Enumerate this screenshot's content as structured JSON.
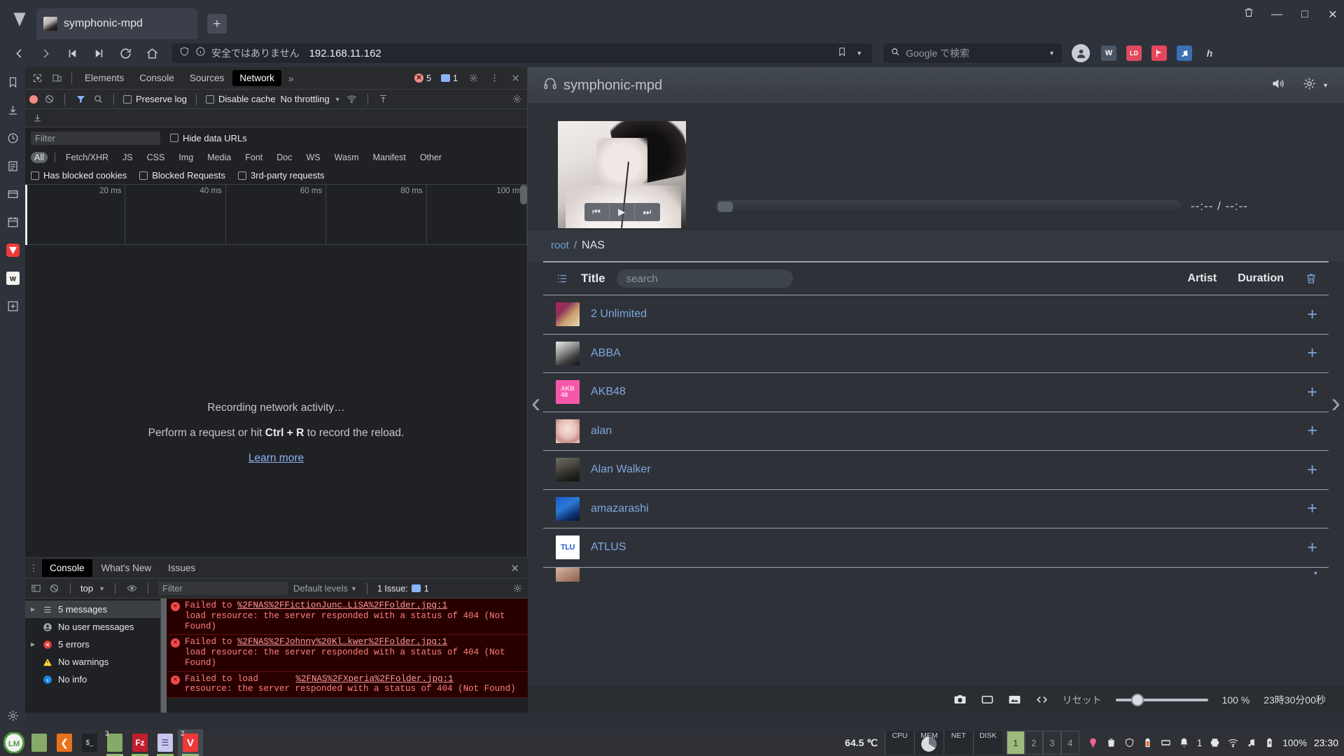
{
  "browser": {
    "tab": {
      "title": "symphonic-mpd",
      "favicon": "album-art-favicon"
    },
    "new_tab_label": "+",
    "window_controls": {
      "trash": "Ὕ1",
      "minimize": "—",
      "maximize": "□",
      "close": "✕"
    },
    "nav": {
      "back": "back-icon",
      "forward": "forward-icon",
      "rewind": "rewind-icon",
      "fastforward": "fastforward-icon",
      "reload": "reload-icon",
      "home": "home-icon"
    },
    "address": {
      "security_label": "安全ではありません",
      "url": "192.168.11.162"
    },
    "search": {
      "placeholder": "Google で検索"
    },
    "extensions": [
      "W",
      "LD",
      "flag-icon",
      "music-icon",
      "h"
    ]
  },
  "rail": {
    "items": [
      {
        "name": "bookmarks"
      },
      {
        "name": "downloads"
      },
      {
        "name": "history"
      },
      {
        "name": "notes"
      },
      {
        "name": "window-panel"
      },
      {
        "name": "calendar"
      },
      {
        "name": "vivaldi-web-panel"
      },
      {
        "name": "wikipedia-web-panel"
      },
      {
        "name": "add-web-panel"
      }
    ],
    "settings": "settings-gear"
  },
  "devtools": {
    "tabs": [
      {
        "label": "Elements",
        "active": false
      },
      {
        "label": "Console",
        "active": false
      },
      {
        "label": "Sources",
        "active": false
      },
      {
        "label": "Network",
        "active": true
      }
    ],
    "more_tabs": "»",
    "error_count": "5",
    "message_count": "1",
    "network_toolbar": {
      "preserve_log": "Preserve log",
      "disable_cache": "Disable cache",
      "throttling": "No throttling"
    },
    "filter": {
      "placeholder": "Filter",
      "hide_data_urls": "Hide data URLs"
    },
    "types": [
      "All",
      "Fetch/XHR",
      "JS",
      "CSS",
      "Img",
      "Media",
      "Font",
      "Doc",
      "WS",
      "Wasm",
      "Manifest",
      "Other"
    ],
    "active_type": "All",
    "checkboxes": [
      "Has blocked cookies",
      "Blocked Requests",
      "3rd-party requests"
    ],
    "timeline_ticks": [
      "20 ms",
      "40 ms",
      "60 ms",
      "80 ms",
      "100 ms"
    ],
    "empty_state": {
      "line1": "Recording network activity…",
      "line2_prefix": "Perform a request or hit ",
      "line2_key": "Ctrl + R",
      "line2_suffix": " to record the reload.",
      "learn_more": "Learn more"
    },
    "drawer": {
      "tabs": [
        {
          "label": "Console",
          "active": true
        },
        {
          "label": "What's New",
          "active": false
        },
        {
          "label": "Issues",
          "active": false
        }
      ],
      "context": "top",
      "filter_placeholder": "Filter",
      "levels": "Default levels",
      "issue_badge": "1 Issue:",
      "issue_count": "1",
      "sidebar": [
        {
          "label": "5 messages",
          "icon": "list-icon",
          "expandable": true,
          "selected": true
        },
        {
          "label": "No user messages",
          "icon": "user-icon",
          "expandable": false,
          "selected": false
        },
        {
          "label": "5 errors",
          "icon": "error-icon",
          "expandable": true,
          "selected": false
        },
        {
          "label": "No warnings",
          "icon": "warning-icon",
          "expandable": false,
          "selected": false
        },
        {
          "label": "No info",
          "icon": "info-icon",
          "expandable": false,
          "selected": false
        }
      ],
      "logs": [
        {
          "pre": "Failed to ",
          "link": "%2FNAS%2FFictionJunc…LiSA%2FFolder.jpg:1",
          "body": "load resource: the server responded with a status of 404 (Not Found)"
        },
        {
          "pre": "Failed to ",
          "link": "%2FNAS%2FJohnny%20Kl…kwer%2FFolder.jpg:1",
          "body": "load resource: the server responded with a status of 404 (Not Found)"
        },
        {
          "pre": "Failed to load ",
          "link": "%2FNAS%2FXperia%2FFolder.jpg:1",
          "body": "resource: the server responded with a status of 404 (Not Found)"
        }
      ]
    }
  },
  "app": {
    "title": "symphonic-mpd",
    "header_icons": [
      "volume-icon",
      "settings-gear-icon"
    ],
    "player": {
      "prev_label": "⏮",
      "play_label": "▶",
      "next_label": "⏭",
      "elapsed": "--:--",
      "separator": "/",
      "total": "--:--"
    },
    "breadcrumb": {
      "root": "root",
      "separator": "/",
      "current": "NAS"
    },
    "list_header": {
      "title": "Title",
      "search_placeholder": "search",
      "artist": "Artist",
      "duration": "Duration",
      "trash": "delete-icon"
    },
    "rows": [
      {
        "name": "2 Unlimited",
        "thumb": "artist-thumb-2unlimited",
        "add": "+"
      },
      {
        "name": "ABBA",
        "thumb": "artist-thumb-abba",
        "add": "+"
      },
      {
        "name": "AKB48",
        "thumb": "artist-thumb-akb48",
        "add": "+"
      },
      {
        "name": "alan",
        "thumb": "artist-thumb-alan",
        "add": "+"
      },
      {
        "name": "Alan Walker",
        "thumb": "artist-thumb-alanwalker",
        "add": "+"
      },
      {
        "name": "amazarashi",
        "thumb": "artist-thumb-amazarashi",
        "add": "+"
      },
      {
        "name": "ATLUS",
        "thumb": "artist-thumb-atlus",
        "add": "+"
      }
    ],
    "nav_prev": "‹",
    "nav_next": "›",
    "footer": {
      "icons": [
        "camera-icon",
        "screen-icon",
        "image-icon",
        "code-icon"
      ],
      "reset": "リセット",
      "zoom": "100 %",
      "time": "23時30分00秒"
    }
  },
  "taskbar": {
    "launchers": [
      {
        "name": "menu",
        "badge": "",
        "running": false
      },
      {
        "name": "file-manager",
        "badge": "",
        "running": false
      },
      {
        "name": "firefox",
        "badge": "",
        "running": false
      },
      {
        "name": "terminal",
        "badge": "",
        "running": false
      },
      {
        "name": "files",
        "badge": "3",
        "running": false
      },
      {
        "name": "filezilla",
        "badge": "",
        "running": false
      },
      {
        "name": "text-editor",
        "badge": "",
        "running": false
      },
      {
        "name": "vivaldi",
        "badge": "2",
        "running": true
      }
    ],
    "temperature": "64.5 ℃",
    "monitors": [
      "CPU",
      "MEM",
      "NET",
      "DISK"
    ],
    "workspaces": [
      "1",
      "2",
      "3",
      "4"
    ],
    "active_workspace": "1",
    "tray": [
      "bulb-icon",
      "trash-icon",
      "shield-icon",
      "battery-warn-icon",
      "keyboard-icon",
      "bell-icon"
    ],
    "bell_count": "1",
    "tray2": [
      "printer-icon",
      "wifi-icon",
      "music-note-icon",
      "battery-icon"
    ],
    "battery": "100%",
    "clock": "23:30"
  }
}
